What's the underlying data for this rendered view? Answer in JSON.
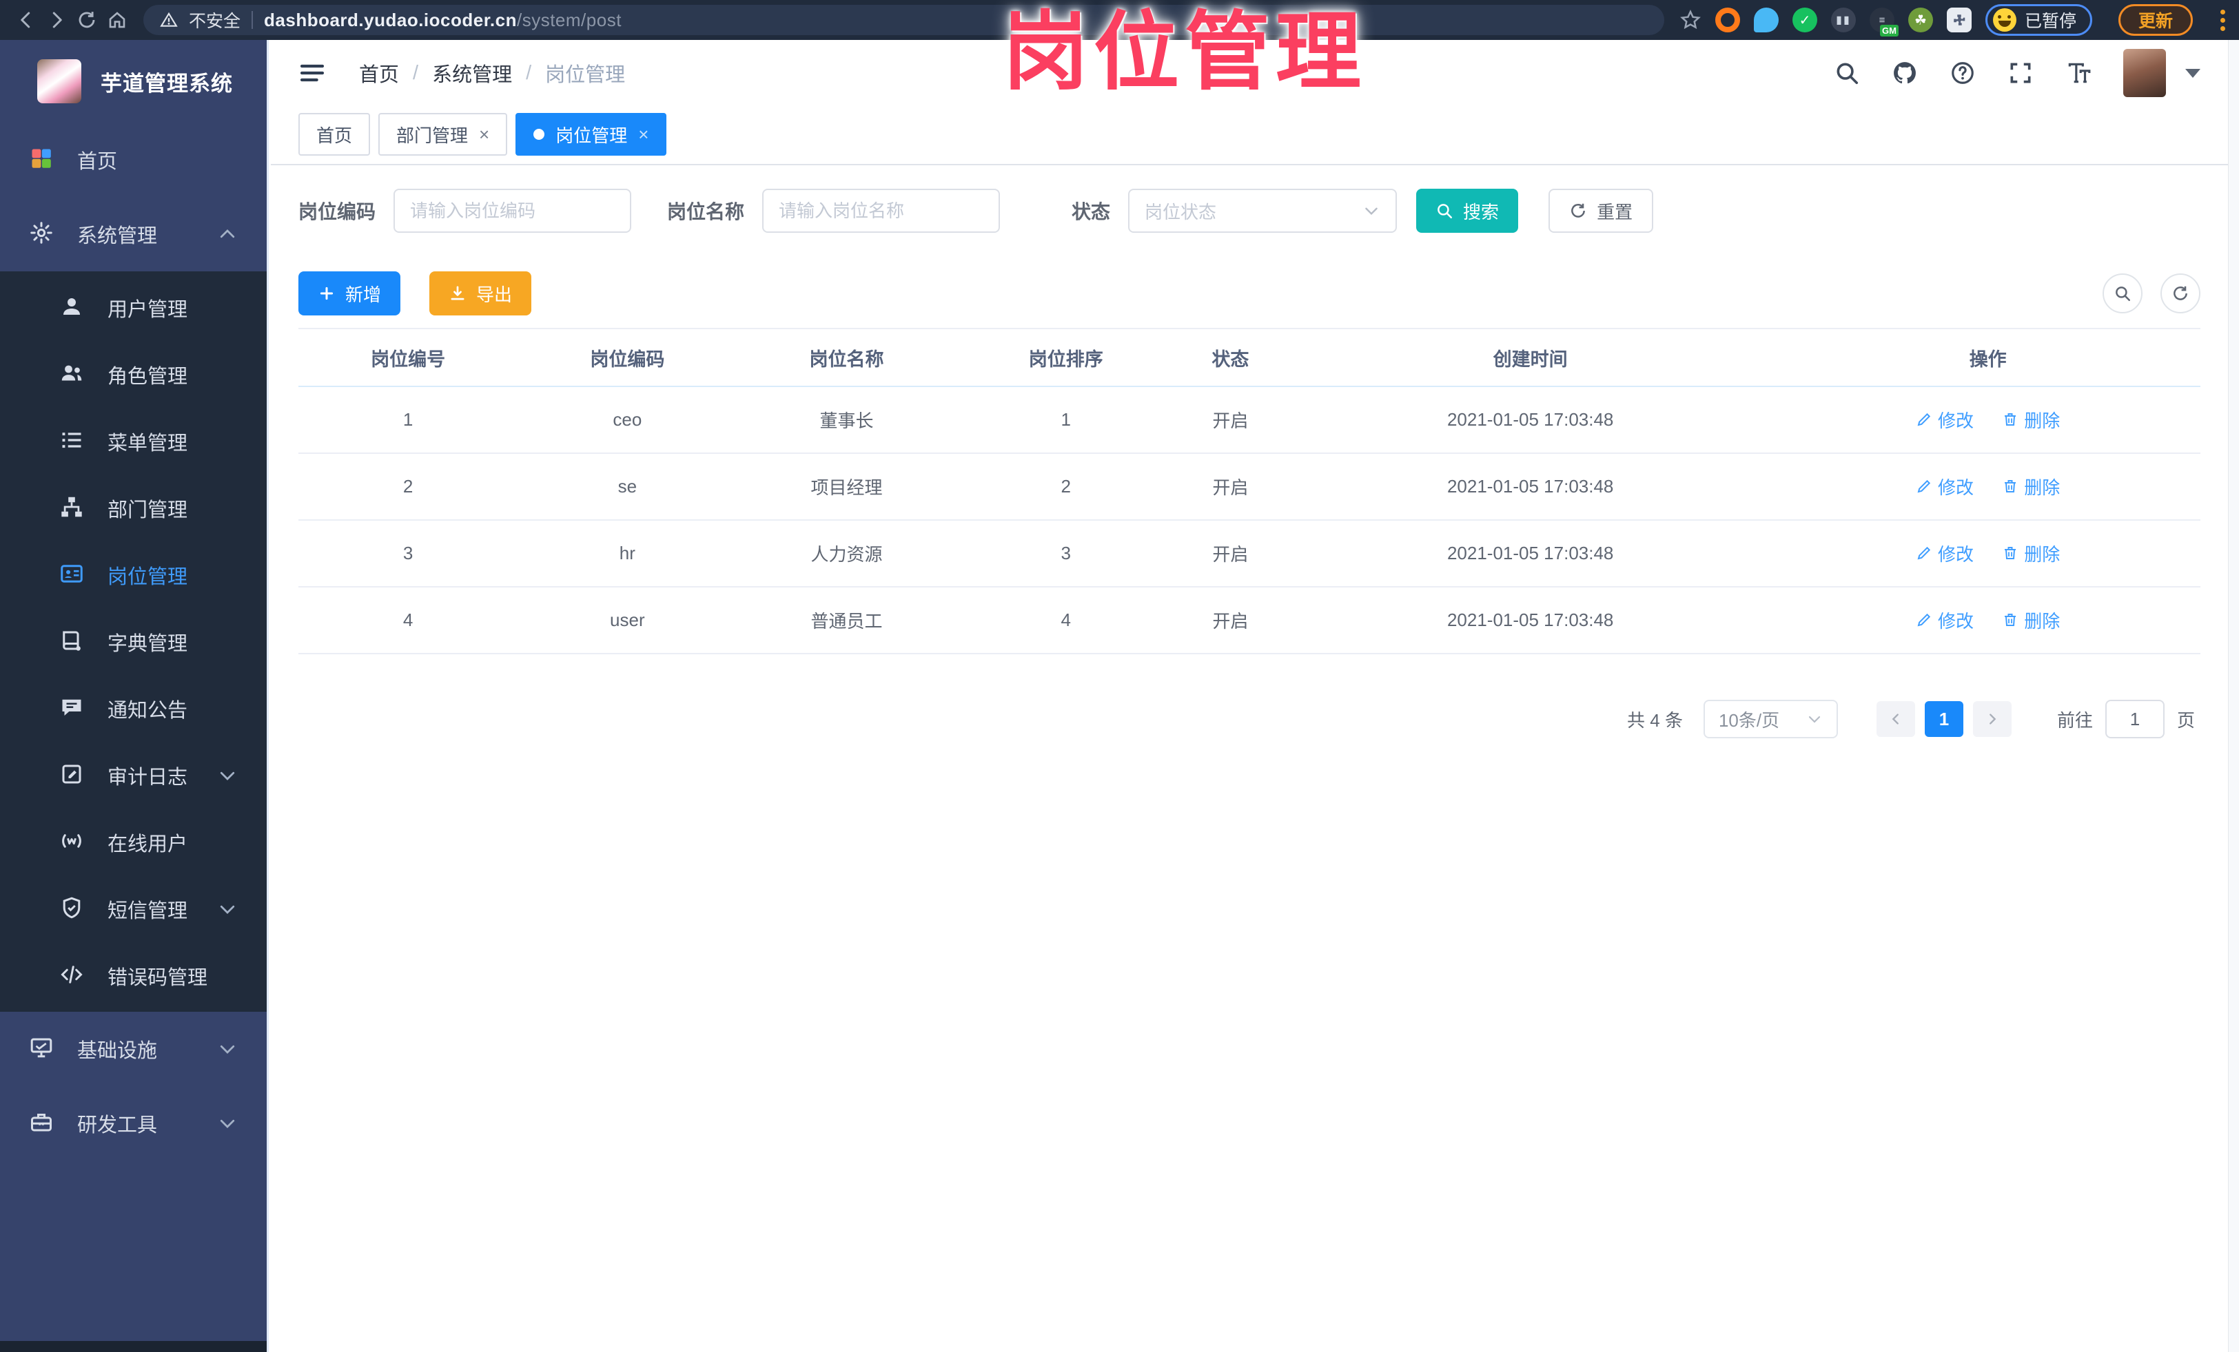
{
  "browser": {
    "security_label": "不安全",
    "url_host": "dashboard.yudao.iocoder.cn",
    "url_path": "/system/post",
    "paused_badge": "已暂停",
    "update_button": "更新",
    "nav_icons": [
      "back-icon",
      "forward-icon",
      "reload-icon",
      "home-icon"
    ],
    "extension_icons": [
      "bookmark-star-icon",
      "orange-ring-extension-icon",
      "blue-drop-extension-icon",
      "green-check-extension-icon",
      "columns-extension-icon",
      "gm-extension-icon",
      "sprout-extension-icon",
      "puzzle-extension-icon"
    ]
  },
  "annotation": {
    "text": "岗位管理",
    "color": "#fb3f60"
  },
  "sidebar": {
    "title": "芋道管理系统",
    "menu": [
      {
        "label": "首页",
        "icon": "dashboard-grid-icon"
      },
      {
        "label": "系统管理",
        "icon": "gear-icon",
        "expanded": true
      },
      {
        "label": "用户管理",
        "icon": "user-icon"
      },
      {
        "label": "角色管理",
        "icon": "roles-icon"
      },
      {
        "label": "菜单管理",
        "icon": "menu-list-icon"
      },
      {
        "label": "部门管理",
        "icon": "org-tree-icon"
      },
      {
        "label": "岗位管理",
        "icon": "post-card-icon",
        "active": true
      },
      {
        "label": "字典管理",
        "icon": "dictionary-icon"
      },
      {
        "label": "通知公告",
        "icon": "announcement-icon"
      },
      {
        "label": "审计日志",
        "icon": "audit-log-icon",
        "collapsed": true
      },
      {
        "label": "在线用户",
        "icon": "online-users-icon"
      },
      {
        "label": "短信管理",
        "icon": "sms-shield-icon",
        "collapsed": true
      },
      {
        "label": "错误码管理",
        "icon": "error-code-icon"
      },
      {
        "label": "基础设施",
        "icon": "infrastructure-icon",
        "collapsed": true
      },
      {
        "label": "研发工具",
        "icon": "dev-tools-icon",
        "collapsed": true
      }
    ]
  },
  "header": {
    "breadcrumb": [
      "首页",
      "系统管理",
      "岗位管理"
    ],
    "icons": [
      "search-icon",
      "github-icon",
      "help-icon",
      "fullscreen-icon",
      "font-size-icon",
      "avatar",
      "caret-down-icon"
    ]
  },
  "tabs": {
    "items": [
      {
        "label": "首页",
        "closable": false,
        "active": false
      },
      {
        "label": "部门管理",
        "closable": true,
        "active": false
      },
      {
        "label": "岗位管理",
        "closable": true,
        "active": true
      }
    ]
  },
  "filters": {
    "code_label": "岗位编码",
    "code_placeholder": "请输入岗位编码",
    "name_label": "岗位名称",
    "name_placeholder": "请输入岗位名称",
    "status_label": "状态",
    "status_placeholder": "岗位状态",
    "search_button": "搜索",
    "reset_button": "重置"
  },
  "toolbar": {
    "add_button": "新增",
    "export_button": "导出",
    "tools": [
      "search-toggle-icon",
      "refresh-icon"
    ]
  },
  "table": {
    "columns": [
      "岗位编号",
      "岗位编码",
      "岗位名称",
      "岗位排序",
      "状态",
      "创建时间",
      "操作"
    ],
    "rows": [
      [
        "1",
        "ceo",
        "董事长",
        "1",
        "开启",
        "2021-01-05 17:03:48"
      ],
      [
        "2",
        "se",
        "项目经理",
        "2",
        "开启",
        "2021-01-05 17:03:48"
      ],
      [
        "3",
        "hr",
        "人力资源",
        "3",
        "开启",
        "2021-01-05 17:03:48"
      ],
      [
        "4",
        "user",
        "普通员工",
        "4",
        "开启",
        "2021-01-05 17:03:48"
      ]
    ],
    "edit_label": "修改",
    "delete_label": "删除"
  },
  "pagination": {
    "total": "共 4 条",
    "page_size": "10条/页",
    "current_page": "1",
    "goto_label": "前往",
    "goto_value": "1",
    "page_unit": "页"
  },
  "colors": {
    "primary_blue": "#1989fa",
    "link_blue": "#409eff",
    "search_teal": "#10b9b4",
    "export_orange": "#f7a723",
    "annotation_pink": "#fb3f60",
    "sidebar_bg": "#36436b",
    "submenu_bg": "#202b3b",
    "chrome_bg": "#202b3c"
  }
}
